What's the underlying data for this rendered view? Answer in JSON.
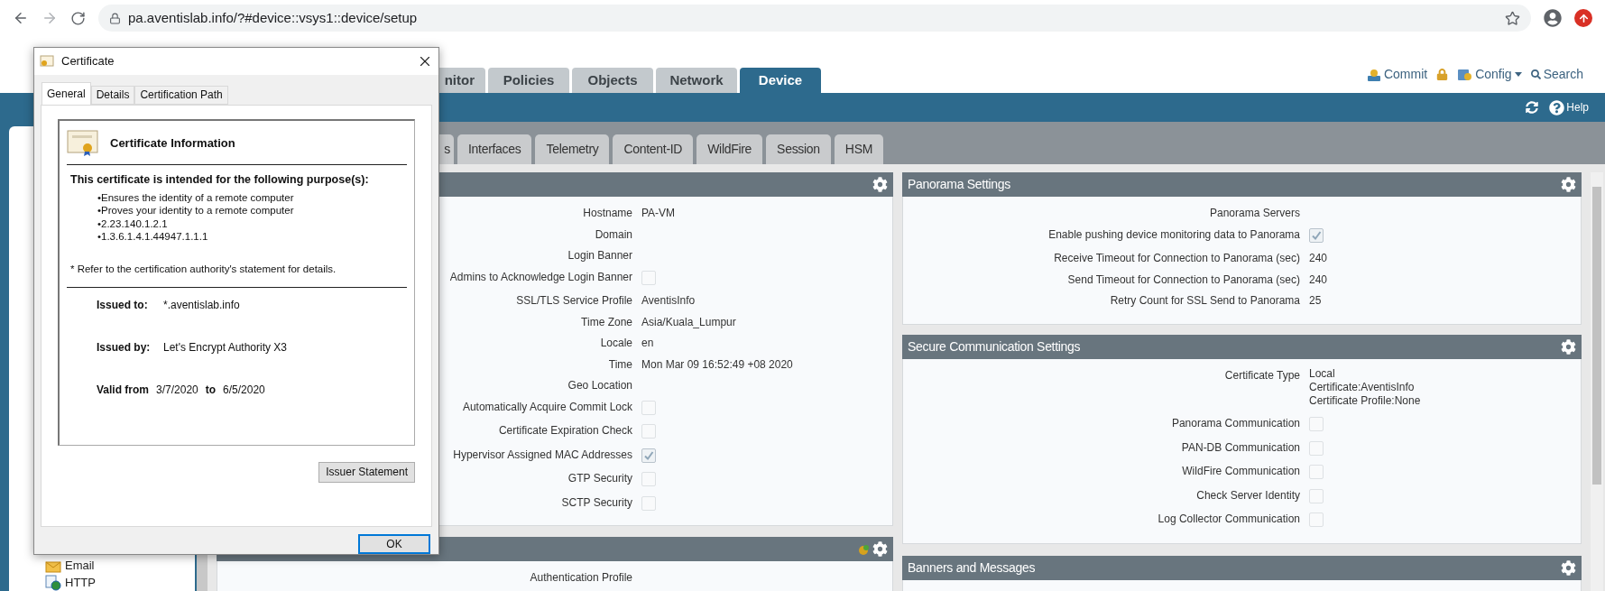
{
  "browser": {
    "url": "pa.aventislab.info/?#device::vsys1::device/setup"
  },
  "main_tabs": [
    {
      "label": "nitor",
      "selected": false
    },
    {
      "label": "Policies",
      "selected": false
    },
    {
      "label": "Objects",
      "selected": false
    },
    {
      "label": "Network",
      "selected": false
    },
    {
      "label": "Device",
      "selected": true
    }
  ],
  "header_actions": [
    {
      "kind": "commit",
      "label": "Commit"
    },
    {
      "kind": "lock"
    },
    {
      "kind": "config",
      "label": "Config"
    },
    {
      "kind": "search",
      "label": "Search"
    }
  ],
  "help": {
    "label": "Help"
  },
  "sidebar": {
    "items": [
      {
        "kind": "email",
        "label": "Email"
      },
      {
        "kind": "http",
        "label": "HTTP"
      }
    ]
  },
  "sub_tabs": [
    {
      "label": "s",
      "selected": false
    },
    {
      "label": "Interfaces",
      "selected": false
    },
    {
      "label": "Telemetry",
      "selected": false
    },
    {
      "label": "Content-ID",
      "selected": false
    },
    {
      "label": "WildFire",
      "selected": false
    },
    {
      "label": "Session",
      "selected": false
    },
    {
      "label": "HSM",
      "selected": false
    }
  ],
  "general_panel": {
    "rows": [
      {
        "kind": "text",
        "label": "Hostname",
        "value": "PA-VM"
      },
      {
        "kind": "text",
        "label": "Domain"
      },
      {
        "kind": "text",
        "label": "Login Banner"
      },
      {
        "kind": "checkbox",
        "label": "Admins to Acknowledge Login Banner",
        "checked": false
      },
      {
        "kind": "text",
        "label": "SSL/TLS Service Profile",
        "value": "AventisInfo"
      },
      {
        "kind": "text",
        "label": "Time Zone",
        "value": "Asia/Kuala_Lumpur"
      },
      {
        "kind": "text",
        "label": "Locale",
        "value": "en"
      },
      {
        "kind": "text",
        "label": "Time",
        "value": "Mon Mar 09 16:52:49 +08 2020"
      },
      {
        "kind": "text",
        "label": "Geo Location"
      },
      {
        "kind": "checkbox",
        "label": "Automatically Acquire Commit Lock",
        "checked": false
      },
      {
        "kind": "checkbox",
        "label": "Certificate Expiration Check",
        "checked": false
      },
      {
        "kind": "checkbox",
        "label": "Hypervisor Assigned MAC Addresses",
        "checked": true
      },
      {
        "kind": "checkbox",
        "label": "GTP Security",
        "checked": false
      },
      {
        "kind": "checkbox",
        "label": "SCTP Security",
        "checked": false
      }
    ]
  },
  "auth_panel": {
    "rows": [
      {
        "kind": "text",
        "label": "Authentication Profile"
      }
    ]
  },
  "panorama_panel": {
    "title": "Panorama Settings",
    "rows": [
      {
        "kind": "text",
        "label": "Panorama Servers"
      },
      {
        "kind": "checkbox",
        "label": "Enable pushing device monitoring data to Panorama",
        "checked": true
      },
      {
        "kind": "text",
        "label": "Receive Timeout for Connection to Panorama (sec)",
        "value": "240"
      },
      {
        "kind": "text",
        "label": "Send Timeout for Connection to Panorama (sec)",
        "value": "240"
      },
      {
        "kind": "text",
        "label": "Retry Count for SSL Send to Panorama",
        "value": "25"
      }
    ]
  },
  "secure_panel": {
    "title": "Secure Communication Settings",
    "rows": [
      {
        "kind": "lines",
        "label": "Certificate Type",
        "lines": [
          "Local",
          "Certificate:AventisInfo",
          "Certificate Profile:None"
        ]
      },
      {
        "kind": "checkbox",
        "label": "Panorama Communication",
        "checked": false
      },
      {
        "kind": "checkbox",
        "label": "PAN-DB Communication",
        "checked": false
      },
      {
        "kind": "checkbox",
        "label": "WildFire Communication",
        "checked": false
      },
      {
        "kind": "checkbox",
        "label": "Check Server Identity",
        "checked": false
      },
      {
        "kind": "checkbox",
        "label": "Log Collector Communication",
        "checked": false
      }
    ]
  },
  "banners_panel": {
    "title": "Banners and Messages"
  },
  "dialog": {
    "title": "Certificate",
    "tabs": [
      {
        "label": "General",
        "selected": true
      },
      {
        "label": "Details",
        "selected": false
      },
      {
        "label": "Certification Path",
        "selected": false
      }
    ],
    "heading": "Certificate Information",
    "purpose_heading": "This certificate is intended for the following purpose(s):",
    "purposes": [
      "•Ensures the identity of a remote computer",
      "•Proves your identity to a remote computer",
      "•2.23.140.1.2.1",
      "•1.3.6.1.4.1.44947.1.1.1"
    ],
    "note": "* Refer to the certification authority's statement for details.",
    "issued_to": {
      "label": "Issued to:",
      "value": "*.aventislab.info"
    },
    "issued_by": {
      "label": "Issued by:",
      "value": "Let's Encrypt Authority X3"
    },
    "valid": {
      "label": "Valid from",
      "from": "3/7/2020",
      "to_label": "to",
      "to": "6/5/2020"
    },
    "buttons": [
      {
        "label": "Issuer Statement",
        "default": false
      },
      {
        "label": "OK",
        "default": true
      }
    ]
  }
}
